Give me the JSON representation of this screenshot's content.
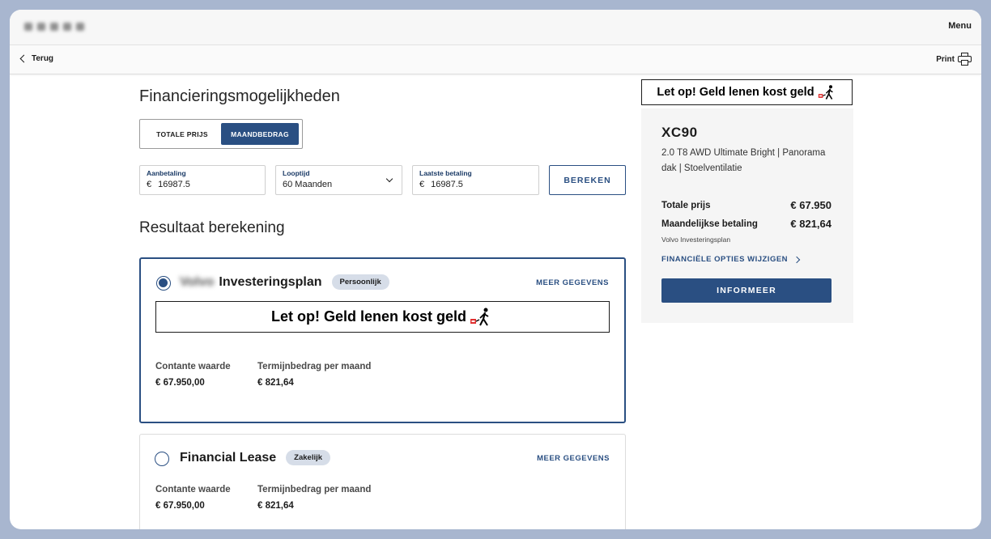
{
  "header": {
    "menu_label": "Menu",
    "back_label": "Terug",
    "print_label": "Print"
  },
  "main": {
    "title": "Financieringsmogelijkheden",
    "toggle": [
      "TOTALE PRIJS",
      "MAANDBEDRAG"
    ],
    "toggle_active": "MAANDBEDRAG",
    "fields": {
      "down_payment": {
        "label": "Aanbetaling",
        "currency": "€",
        "value": "16987.5"
      },
      "term": {
        "label": "Looptijd",
        "value": "60 Maanden"
      },
      "last_payment": {
        "label": "Laatste betaling",
        "currency": "€",
        "value": "16987.5"
      }
    },
    "calculate_label": "BEREKEN",
    "results_title": "Resultaat berekening"
  },
  "plans": [
    {
      "brand": "Volvo",
      "name": "Investeringsplan",
      "badge": "Persoonlijk",
      "more_label": "MEER GEGEVENS",
      "warning": "Let op! Geld lenen kost geld",
      "cash_value_label": "Contante waarde",
      "cash_value": "€ 67.950,00",
      "monthly_label": "Termijnbedrag per maand",
      "monthly": "€ 821,64",
      "selected": true
    },
    {
      "name": "Financial Lease",
      "badge": "Zakelijk",
      "more_label": "MEER GEGEVENS",
      "cash_value_label": "Contante waarde",
      "cash_value": "€ 67.950,00",
      "monthly_label": "Termijnbedrag per maand",
      "monthly": "€ 821,64",
      "selected": false
    }
  ],
  "summary": {
    "warning": "Let op! Geld lenen kost geld",
    "model": "XC90",
    "variant": "2.0 T8 AWD Ultimate Bright | Panorama dak | Stoelventilatie",
    "total_label": "Totale prijs",
    "total_value": "€ 67.950",
    "monthly_label": "Maandelijkse betaling",
    "monthly_value": "€ 821,64",
    "plan_name": "Volvo Investeringsplan",
    "change_link": "FINANCIËLE OPTIES WIJZIGEN",
    "cta": "INFORMEER"
  },
  "colors": {
    "accent": "#2a4f82",
    "frame": "#a8b6cf"
  }
}
